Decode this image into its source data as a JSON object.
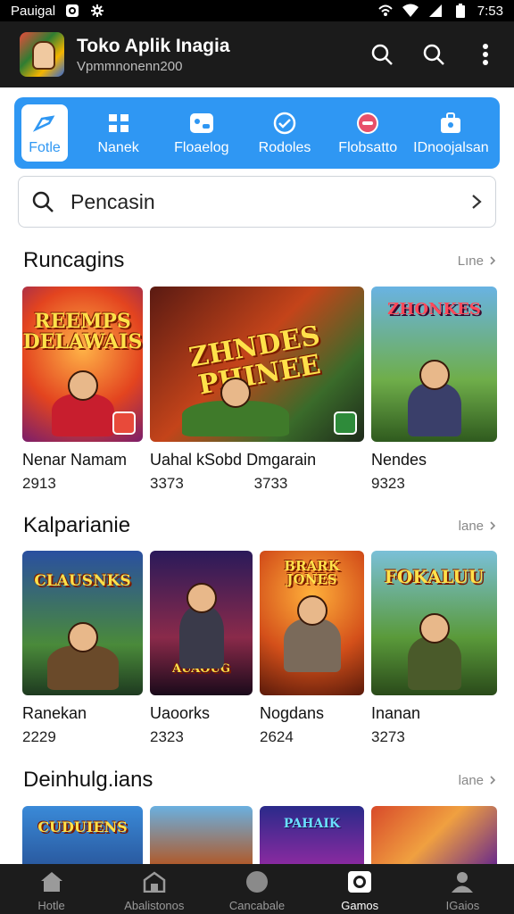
{
  "status_bar": {
    "carrier": "Pauigal",
    "time": "7:53"
  },
  "app_bar": {
    "title": "Toko Aplik Inagia",
    "subtitle": "Vpmmnonenn200"
  },
  "categories": [
    {
      "label": "Fotle",
      "icon": "controller-icon",
      "active": true
    },
    {
      "label": "Nanek",
      "icon": "grid-icon"
    },
    {
      "label": "Floaelog",
      "icon": "puzzle-icon"
    },
    {
      "label": "Rodoles",
      "icon": "check-circle-icon"
    },
    {
      "label": "Flobsatto",
      "icon": "minus-circle-icon"
    },
    {
      "label": "IDnoojalsan",
      "icon": "briefcase-icon"
    }
  ],
  "search": {
    "placeholder": "Pencasin"
  },
  "sections": [
    {
      "title": "Runcagins",
      "more": "Lıne",
      "items": [
        {
          "name": "Nenar Namam",
          "count": "2913",
          "art": "REEMPS DELAWAIS"
        },
        {
          "name": "Uahal kSobd Dmgarain",
          "count": "3373",
          "count2": "3733",
          "art": "ZHNDES PHINEE"
        },
        {
          "name": "Nendes",
          "count": "9323",
          "art": "ZHONKES"
        }
      ]
    },
    {
      "title": "Kalparianie",
      "more": "lane",
      "items": [
        {
          "name": "Ranekan",
          "count": "2229",
          "art": "CLAUSNKS"
        },
        {
          "name": "Uaoorks",
          "count": "2323",
          "art": "AUAOUG"
        },
        {
          "name": "Nogdans",
          "count": "2624",
          "art": "BRARK JONES"
        },
        {
          "name": "Inanan",
          "count": "3273",
          "art": "FOKALUU"
        }
      ]
    },
    {
      "title": "Deinhulg.ians",
      "more": "lane",
      "items": [
        {
          "art": "CUDUIENS"
        },
        {
          "art": ""
        },
        {
          "art": "PAHAIK"
        },
        {
          "art": ""
        }
      ]
    }
  ],
  "bottom_nav": [
    {
      "label": "Hotle",
      "icon": "home-icon"
    },
    {
      "label": "Abalistonos",
      "icon": "shop-icon"
    },
    {
      "label": "Cancabale",
      "icon": "circle-icon"
    },
    {
      "label": "Gamos",
      "icon": "camera-icon",
      "active": true
    },
    {
      "label": "IGaios",
      "icon": "person-icon"
    }
  ],
  "colors": {
    "accent": "#2f97f3",
    "appbar": "#1b1b1b",
    "nav": "#1c1c1c"
  }
}
